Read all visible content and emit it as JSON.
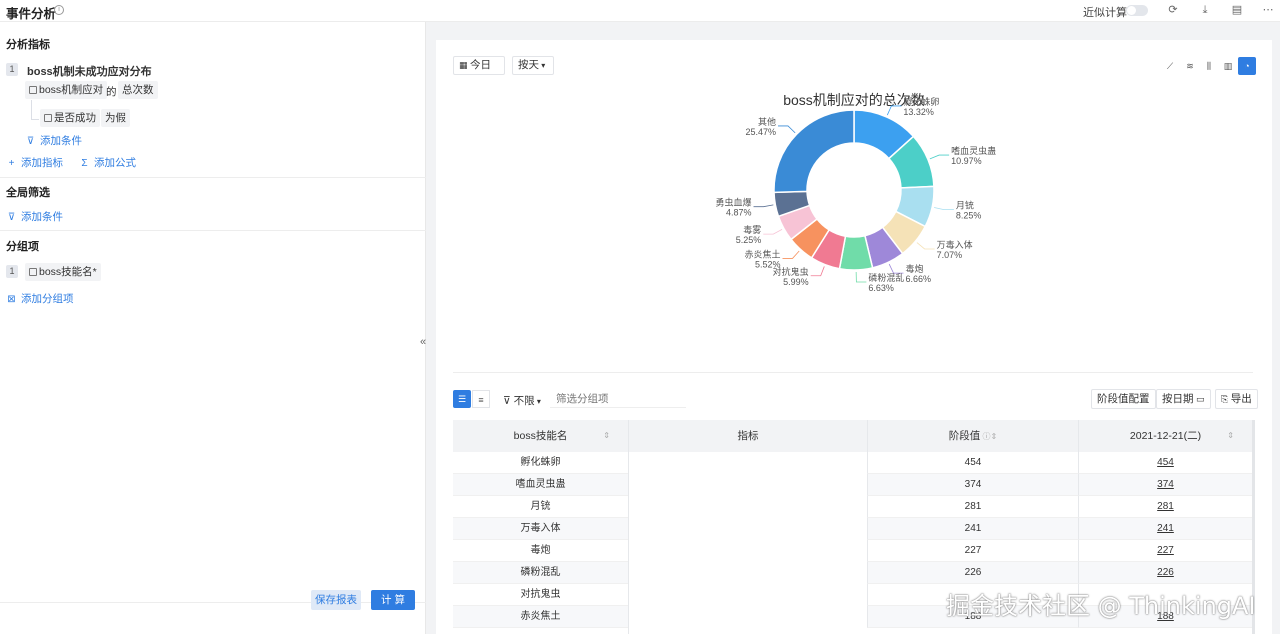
{
  "header": {
    "title": "事件分析",
    "approx_label": "近似计算"
  },
  "left_panel": {
    "metrics_title": "分析指标",
    "metric_index": "1",
    "metric_name": "boss机制未成功应对分布",
    "event_chip": "boss机制应对",
    "of_text": "的",
    "agg_chip": "总次数",
    "filter_prop_chip": "是否成功",
    "filter_value_chip": "为假",
    "add_condition": "添加条件",
    "add_metric": "添加指标",
    "add_formula": "添加公式",
    "global_filter_title": "全局筛选",
    "global_add_condition": "添加条件",
    "group_title": "分组项",
    "group_index": "1",
    "group_chip": "boss技能名*",
    "add_group": "添加分组项",
    "save_button": "保存报表",
    "calc_button": "计 算"
  },
  "toolbar": {
    "date_label": "今日",
    "granularity_label": "按天"
  },
  "chart_data": {
    "type": "pie",
    "title": "boss机制应对的总次数",
    "categories": [
      "孵化蛛卵",
      "嗜血灵虫蛊",
      "月铳",
      "万毒入体",
      "毒炮",
      "磷粉混乱",
      "对抗鬼虫",
      "赤炎焦土",
      "毒雾",
      "勇虫血爆",
      "其他"
    ],
    "percent_labels": [
      "13.32%",
      "10.97%",
      "8.25%",
      "7.07%",
      "6.66%",
      "6.63%",
      "5.99%",
      "5.52%",
      "5.25%",
      "4.87%",
      "25.47%"
    ],
    "values": [
      13.32,
      10.97,
      8.25,
      7.07,
      6.66,
      6.63,
      5.99,
      5.52,
      5.25,
      4.87,
      25.47
    ],
    "colors": [
      "#3ca0f0",
      "#4ccfc8",
      "#a9dff0",
      "#f5e2b7",
      "#9e88d9",
      "#70dca9",
      "#f07a92",
      "#f7925f",
      "#f7c3d5",
      "#5b7193",
      "#3a8bd6"
    ]
  },
  "table_controls": {
    "filter_label": "不限",
    "filter_placeholder": "筛选分组项",
    "stage_config": "阶段值配置",
    "by_date": "按日期",
    "export": "导出"
  },
  "table": {
    "headers": [
      "boss技能名",
      "指标",
      "阶段值",
      "2021-12-21(二)"
    ],
    "rows": [
      {
        "name": "孵化蛛卵",
        "stage": "454",
        "day": "454"
      },
      {
        "name": "嗜血灵虫蛊",
        "stage": "374",
        "day": "374"
      },
      {
        "name": "月铳",
        "stage": "281",
        "day": "281"
      },
      {
        "name": "万毒入体",
        "stage": "241",
        "day": "241"
      },
      {
        "name": "毒炮",
        "stage": "227",
        "day": "227"
      },
      {
        "name": "磷粉混乱",
        "stage": "226",
        "day": "226"
      },
      {
        "name": "对抗鬼虫",
        "stage": "",
        "day": ""
      },
      {
        "name": "赤炎焦土",
        "stage": "188",
        "day": "188"
      }
    ]
  },
  "watermark": "掘金技术社区 @ ThinkingAI"
}
